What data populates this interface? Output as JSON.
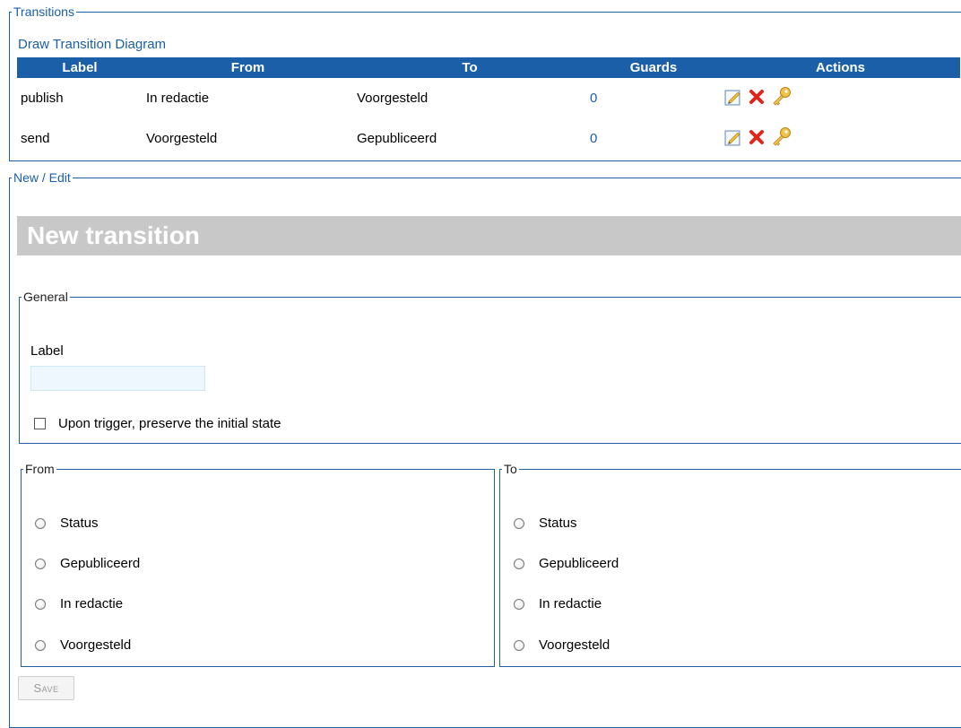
{
  "transitions": {
    "legend": "Transitions",
    "draw_link": "Draw Transition Diagram",
    "columns": [
      "Label",
      "From",
      "To",
      "Guards",
      "Actions"
    ],
    "rows": [
      {
        "label": "publish",
        "from": "In redactie",
        "to": "Voorgesteld",
        "guards": "0"
      },
      {
        "label": "send",
        "from": "Voorgesteld",
        "to": "Gepubliceerd",
        "guards": "0"
      }
    ],
    "action_icons": [
      "edit-icon",
      "delete-icon",
      "key-icon"
    ]
  },
  "new_edit": {
    "legend": "New / Edit",
    "title": "New transition",
    "general": {
      "legend": "General",
      "label_text": "Label",
      "label_value": "",
      "checkbox_label": "Upon trigger, preserve the initial state",
      "checkbox_checked": false
    },
    "from": {
      "legend": "From",
      "options": [
        "Status",
        "Gepubliceerd",
        "In redactie",
        "Voorgesteld"
      ]
    },
    "to": {
      "legend": "To",
      "options": [
        "Status",
        "Gepubliceerd",
        "In redactie",
        "Voorgesteld"
      ]
    },
    "save_label": "Save"
  },
  "colors": {
    "accent": "#1b5fa8",
    "title_bar": "#c8c8c8"
  }
}
